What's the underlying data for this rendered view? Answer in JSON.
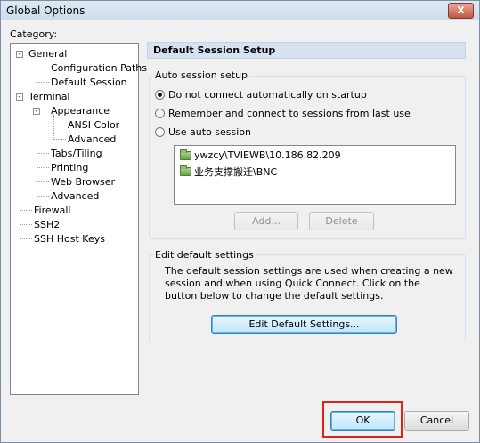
{
  "window": {
    "title": "Global Options",
    "close_glyph": "x"
  },
  "category": {
    "label": "Category:",
    "items": [
      {
        "label": "General",
        "level": 0,
        "expander": "-"
      },
      {
        "label": "Configuration Paths",
        "level": 1
      },
      {
        "label": "Default Session",
        "level": 1,
        "selected": true
      },
      {
        "label": "Terminal",
        "level": 0,
        "expander": "-"
      },
      {
        "label": "Appearance",
        "level": 1,
        "expander": "-"
      },
      {
        "label": "ANSI Color",
        "level": 2
      },
      {
        "label": "Advanced",
        "level": 2
      },
      {
        "label": "Tabs/Tiling",
        "level": 1
      },
      {
        "label": "Printing",
        "level": 1
      },
      {
        "label": "Web Browser",
        "level": 1
      },
      {
        "label": "Advanced",
        "level": 1
      },
      {
        "label": "Firewall",
        "level": 0
      },
      {
        "label": "SSH2",
        "level": 0
      },
      {
        "label": "SSH Host Keys",
        "level": 0
      }
    ]
  },
  "panel": {
    "header": "Default Session Setup"
  },
  "auto_session": {
    "legend": "Auto session setup",
    "options": [
      {
        "label": "Do not connect automatically on startup",
        "checked": true
      },
      {
        "label": "Remember and connect to sessions from last use",
        "checked": false
      },
      {
        "label": "Use auto session",
        "checked": false
      }
    ],
    "sessions": [
      "ywzcy\\TVIEWB\\10.186.82.209",
      "业务支撑搬迁\\BNC"
    ],
    "add_label": "Add...",
    "delete_label": "Delete"
  },
  "edit_defaults": {
    "legend": "Edit default settings",
    "description_lines": [
      "The default session settings are used when creating a new",
      "session and when using Quick Connect.  Click on the",
      "button below to change the default settings."
    ],
    "button_label": "Edit Default Settings..."
  },
  "footer": {
    "ok_label": "OK",
    "cancel_label": "Cancel"
  },
  "colors": {
    "highlight": "#e0201a",
    "header_bg": "#d6e2ef",
    "default_button": "#3c7fb1"
  }
}
